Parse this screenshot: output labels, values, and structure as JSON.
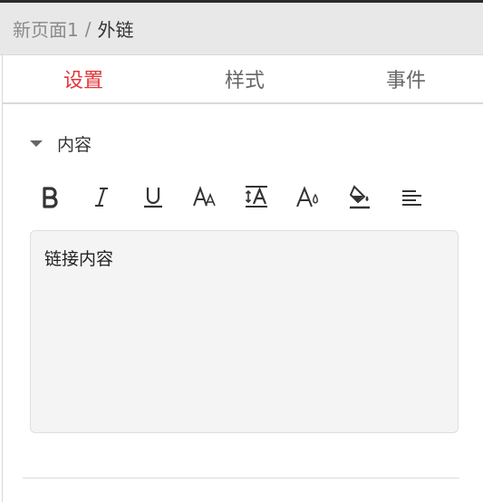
{
  "breadcrumb": {
    "parent": "新页面1",
    "separator": "/",
    "current": "外链"
  },
  "tabs": [
    {
      "label": "设置",
      "active": true
    },
    {
      "label": "样式",
      "active": false
    },
    {
      "label": "事件",
      "active": false
    }
  ],
  "section": {
    "title": "内容",
    "expanded": true
  },
  "toolbar": {
    "tools": [
      "bold-icon",
      "italic-icon",
      "underline-icon",
      "font-size-icon",
      "line-height-icon",
      "font-color-icon",
      "fill-color-icon",
      "align-left-icon"
    ]
  },
  "editor": {
    "content": "链接内容"
  },
  "colors": {
    "accent": "#e0363a",
    "breadcrumb_bg": "#e8e8e8",
    "editor_bg": "#f4f4f4"
  }
}
